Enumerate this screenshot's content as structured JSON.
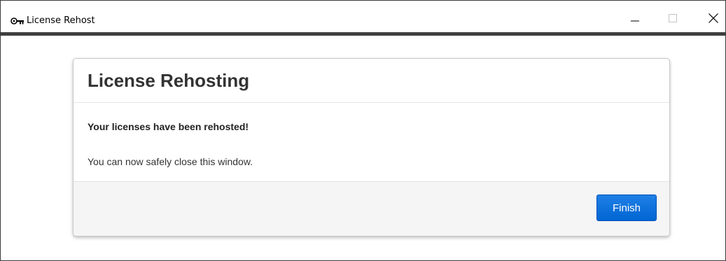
{
  "window": {
    "title": "License Rehost",
    "icon": "key-icon",
    "controls": [
      "minimize-icon",
      "maximize-icon",
      "close-icon"
    ]
  },
  "panel": {
    "title": "License Rehosting",
    "message_strong": "Your licenses have been rehosted!",
    "message": "You can now safely close this window.",
    "finish_label": "Finish"
  },
  "colors": {
    "accent": "#0066d3",
    "footer_bg": "#f5f5f5",
    "title_text": "#333333"
  }
}
